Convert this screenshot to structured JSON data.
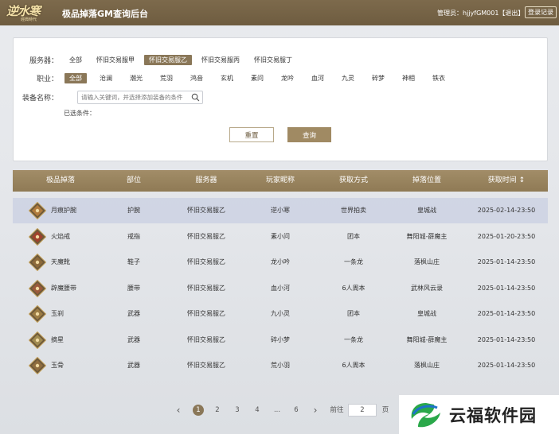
{
  "header": {
    "logo_text": "逆水寒",
    "logo_sub": "經典時代",
    "title": "极品掉落GM查询后台",
    "admin_text": "管理员：hjjyfGM001【退出】",
    "logs_button": "登录记录"
  },
  "filter": {
    "server_label": "服务器：",
    "servers": [
      "全部",
      "怀旧交易服甲",
      "怀旧交易服乙",
      "怀旧交易服丙",
      "怀旧交易服丁"
    ],
    "server_selected": "怀旧交易服乙",
    "class_label": "职业：",
    "classes": [
      "全部",
      "沧澜",
      "潮光",
      "荒羽",
      "鸿音",
      "玄机",
      "素问",
      "龙吟",
      "血河",
      "九灵",
      "碎梦",
      "神相",
      "铁衣"
    ],
    "class_selected": "全部",
    "equip_label": "装备名称：",
    "equip_placeholder": "请输入关键词，并选择添加装备的条件",
    "selected_label": "已选条件：",
    "reset_button": "重置",
    "query_button": "查询"
  },
  "table": {
    "headers": [
      "极品掉落",
      "部位",
      "服务器",
      "玩家昵称",
      "获取方式",
      "掉落位置",
      "获取时间 ↕"
    ],
    "rows": [
      {
        "name": "月痕护腕",
        "slot": "护腕",
        "server": "怀旧交易服乙",
        "player": "逆小寒",
        "method": "世界拍卖",
        "location": "皇城战",
        "time": "2025-02-14-23:50"
      },
      {
        "name": "火焰戒",
        "slot": "戒指",
        "server": "怀旧交易服乙",
        "player": "素小问",
        "method": "团本",
        "location": "舞阳城-薛魔主",
        "time": "2025-01-20-23:50"
      },
      {
        "name": "天魔靴",
        "slot": "鞋子",
        "server": "怀旧交易服乙",
        "player": "龙小吟",
        "method": "一条龙",
        "location": "落枫山庄",
        "time": "2025-01-14-23:50"
      },
      {
        "name": "辟魔腰带",
        "slot": "腰带",
        "server": "怀旧交易服乙",
        "player": "血小河",
        "method": "6人周本",
        "location": "武林风云录",
        "time": "2025-01-14-23:50"
      },
      {
        "name": "玉刹",
        "slot": "武器",
        "server": "怀旧交易服乙",
        "player": "九小灵",
        "method": "团本",
        "location": "皇城战",
        "time": "2025-01-14-23:50"
      },
      {
        "name": "摘星",
        "slot": "武器",
        "server": "怀旧交易服乙",
        "player": "碎小梦",
        "method": "一条龙",
        "location": "舞阳城-薛魔主",
        "time": "2025-01-14-23:50"
      },
      {
        "name": "玉骨",
        "slot": "武器",
        "server": "怀旧交易服乙",
        "player": "荒小羽",
        "method": "6人周本",
        "location": "落枫山庄",
        "time": "2025-01-14-23:50"
      }
    ]
  },
  "pagination": {
    "prev": "‹",
    "pages": [
      "1",
      "2",
      "3",
      "4",
      "...",
      "6"
    ],
    "current": "1",
    "next": "›",
    "goto_label": "前往",
    "goto_value": "2",
    "page_unit": "页"
  },
  "watermark": {
    "text": "云福软件园"
  },
  "colors": {
    "header_bg": "#7d6a4c",
    "accent": "#8a7758",
    "table_header": "#a28d68",
    "row_highlight": "#c4cde0"
  }
}
